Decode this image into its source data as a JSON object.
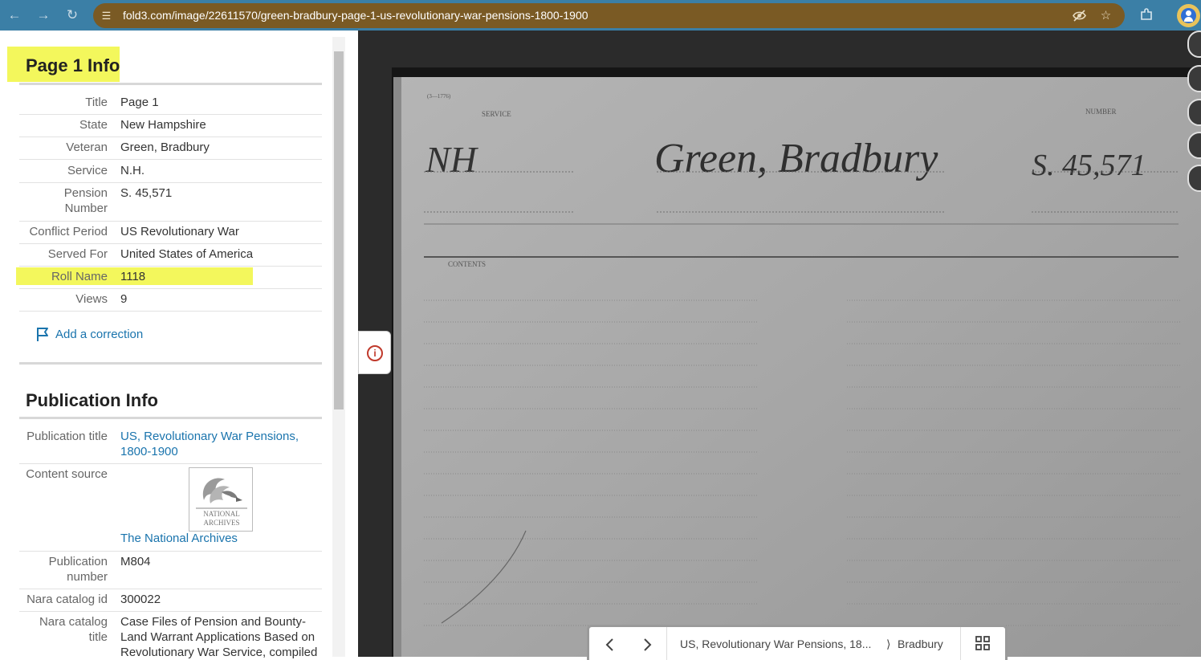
{
  "browser": {
    "url": "fold3.com/image/22611570/green-bradbury-page-1-us-revolutionary-war-pensions-1800-1900"
  },
  "page_info": {
    "heading": "Page 1 Info",
    "rows": [
      {
        "label": "Title",
        "value": "Page 1"
      },
      {
        "label": "State",
        "value": "New Hampshire"
      },
      {
        "label": "Veteran",
        "value": "Green, Bradbury"
      },
      {
        "label": "Service",
        "value": "N.H."
      },
      {
        "label": "Pension Number",
        "value": "S. 45,571"
      },
      {
        "label": "Conflict Period",
        "value": "US Revolutionary War"
      },
      {
        "label": "Served For",
        "value": "United States of America"
      },
      {
        "label": "Roll Name",
        "value": "1118"
      },
      {
        "label": "Views",
        "value": "9"
      }
    ],
    "correction_link": "Add a correction"
  },
  "publication_info": {
    "heading": "Publication Info",
    "rows": [
      {
        "label": "Publication title",
        "value": "US, Revolutionary War Pensions, 1800-1900"
      },
      {
        "label": "Content source",
        "value": "The National Archives"
      },
      {
        "label": "Publication number",
        "value": "M804"
      },
      {
        "label": "Nara catalog id",
        "value": "300022"
      },
      {
        "label": "Nara catalog title",
        "value": "Case Files of Pension and Bounty-Land Warrant Applications Based on Revolutionary War Service, compiled"
      }
    ],
    "logo_text": [
      "NATIONAL",
      "ARCHIVES"
    ]
  },
  "document": {
    "form_code": "(3—1776)",
    "service_label": "SERVICE",
    "number_label": "NUMBER",
    "contents_label": "CONTENTS",
    "service_hand": "NH",
    "name_hand": "Green, Bradbury",
    "number_hand": "S. 45,571"
  },
  "viewer_nav": {
    "breadcrumb_collection": "US, Revolutionary War Pensions, 18...",
    "breadcrumb_sep": "⟩",
    "breadcrumb_name": "Bradbury"
  },
  "colors": {
    "highlight": "#f3f75c",
    "link": "#1a74ad",
    "chrome": "#3b7fa6",
    "urlbar": "#7a5a24"
  }
}
